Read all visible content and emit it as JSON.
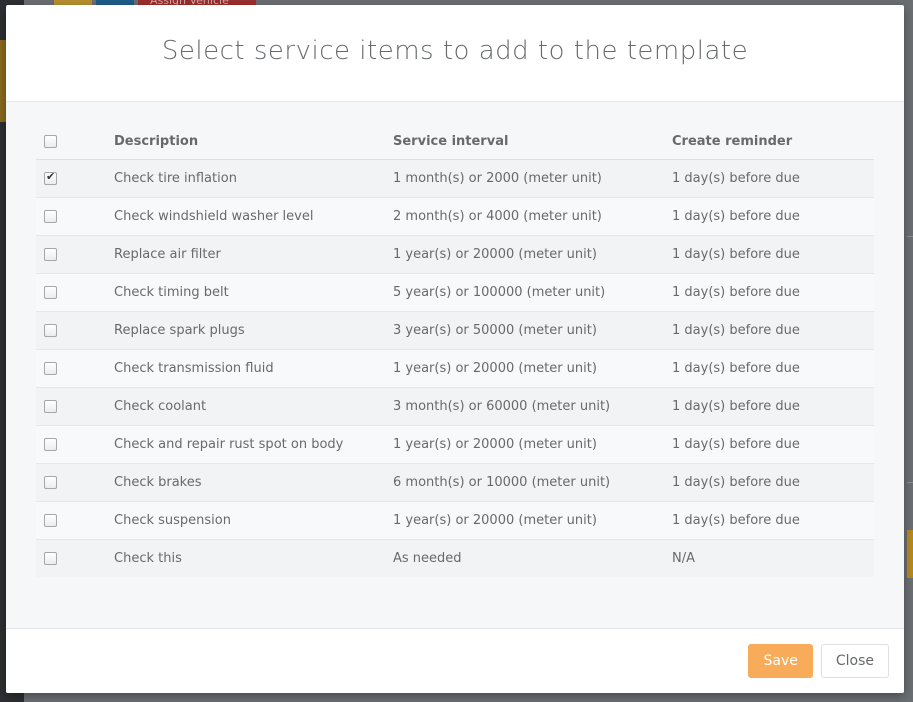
{
  "background": {
    "assign_button_label": "Assign Vehicle"
  },
  "modal": {
    "title": "Select service items to add to the template",
    "columns": {
      "description": "Description",
      "interval": "Service interval",
      "reminder": "Create reminder"
    },
    "select_all_checked": false,
    "rows": [
      {
        "checked": true,
        "description": "Check tire inflation",
        "interval": "1 month(s) or 2000 (meter unit)",
        "reminder": "1 day(s) before due"
      },
      {
        "checked": false,
        "description": "Check windshield washer level",
        "interval": "2 month(s) or 4000 (meter unit)",
        "reminder": "1 day(s) before due"
      },
      {
        "checked": false,
        "description": "Replace air filter",
        "interval": "1 year(s) or 20000 (meter unit)",
        "reminder": "1 day(s) before due"
      },
      {
        "checked": false,
        "description": "Check timing belt",
        "interval": "5 year(s) or 100000 (meter unit)",
        "reminder": "1 day(s) before due"
      },
      {
        "checked": false,
        "description": "Replace spark plugs",
        "interval": "3 year(s) or 50000 (meter unit)",
        "reminder": "1 day(s) before due"
      },
      {
        "checked": false,
        "description": "Check transmission fluid",
        "interval": "1 year(s) or 20000 (meter unit)",
        "reminder": "1 day(s) before due"
      },
      {
        "checked": false,
        "description": "Check coolant",
        "interval": "3 month(s) or 60000 (meter unit)",
        "reminder": "1 day(s) before due"
      },
      {
        "checked": false,
        "description": "Check and repair rust spot on body",
        "interval": "1 year(s) or 20000 (meter unit)",
        "reminder": "1 day(s) before due"
      },
      {
        "checked": false,
        "description": "Check brakes",
        "interval": "6 month(s) or 10000 (meter unit)",
        "reminder": "1 day(s) before due"
      },
      {
        "checked": false,
        "description": "Check suspension",
        "interval": "1 year(s) or 20000 (meter unit)",
        "reminder": "1 day(s) before due"
      },
      {
        "checked": false,
        "description": "Check this",
        "interval": "As needed",
        "reminder": "N/A"
      }
    ],
    "footer": {
      "save_label": "Save",
      "close_label": "Close"
    }
  },
  "colors": {
    "accent": "#f8ac59",
    "text": "#676a6c"
  }
}
